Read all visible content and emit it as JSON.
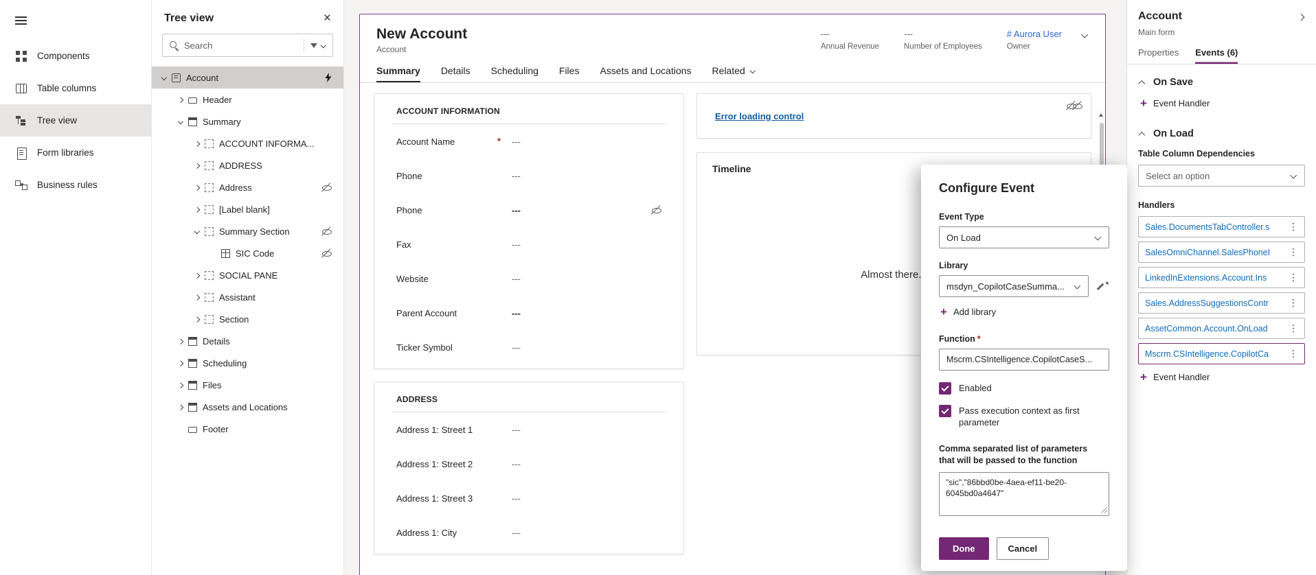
{
  "colors": {
    "accent_purple": "#742774",
    "link_blue": "#115ea3",
    "owner_blue": "#2266E3",
    "required_red": "#a4262c"
  },
  "left_nav": {
    "items": [
      {
        "label": "Components",
        "icon": "components-icon"
      },
      {
        "label": "Table columns",
        "icon": "table-columns-icon"
      },
      {
        "label": "Tree view",
        "icon": "tree-view-icon",
        "selected": true
      },
      {
        "label": "Form libraries",
        "icon": "form-libraries-icon"
      },
      {
        "label": "Business rules",
        "icon": "business-rules-icon"
      }
    ]
  },
  "tree_panel": {
    "title": "Tree view",
    "search_placeholder": "Search",
    "items": [
      {
        "label": "Account",
        "icon": "form-icon",
        "chevron": "down",
        "depth": 0,
        "selected": true,
        "bolt": true
      },
      {
        "label": "Header",
        "icon": "label-icon",
        "chevron": "right",
        "depth": 1
      },
      {
        "label": "Summary",
        "icon": "tab-icon",
        "chevron": "down",
        "depth": 1
      },
      {
        "label": "ACCOUNT INFORMA...",
        "icon": "section-icon",
        "chevron": "right",
        "depth": 2
      },
      {
        "label": "ADDRESS",
        "icon": "section-icon",
        "chevron": "right",
        "depth": 2
      },
      {
        "label": "Address",
        "icon": "section-icon",
        "chevron": "right",
        "depth": 2,
        "hidden": true
      },
      {
        "label": "[Label blank]",
        "icon": "section-icon",
        "chevron": "right",
        "depth": 2
      },
      {
        "label": "Summary Section",
        "icon": "section-icon",
        "chevron": "down",
        "depth": 2,
        "hidden": true
      },
      {
        "label": "SIC Code",
        "icon": "grid-icon",
        "chevron": "none",
        "depth": 3,
        "hidden": true
      },
      {
        "label": "SOCIAL PANE",
        "icon": "section-icon",
        "chevron": "right",
        "depth": 2
      },
      {
        "label": "Assistant",
        "icon": "section-icon",
        "chevron": "right",
        "depth": 2
      },
      {
        "label": "Section",
        "icon": "section-icon",
        "chevron": "right",
        "depth": 2
      },
      {
        "label": "Details",
        "icon": "tab-icon",
        "chevron": "right",
        "depth": 1
      },
      {
        "label": "Scheduling",
        "icon": "tab-icon",
        "chevron": "right",
        "depth": 1
      },
      {
        "label": "Files",
        "icon": "tab-icon",
        "chevron": "right",
        "depth": 1
      },
      {
        "label": "Assets and Locations",
        "icon": "tab-icon",
        "chevron": "right",
        "depth": 1
      },
      {
        "label": "Footer",
        "icon": "label-icon",
        "chevron": "none",
        "depth": 1
      }
    ]
  },
  "form": {
    "title": "New Account",
    "entity": "Account",
    "header_stats": [
      {
        "value": "---",
        "label": "Annual Revenue"
      },
      {
        "value": "---",
        "label": "Number of Employees"
      },
      {
        "value": "# Aurora User",
        "label": "Owner",
        "link": true
      }
    ],
    "tabs": [
      {
        "label": "Summary",
        "selected": true
      },
      {
        "label": "Details"
      },
      {
        "label": "Scheduling"
      },
      {
        "label": "Files"
      },
      {
        "label": "Assets and Locations"
      },
      {
        "label": "Related",
        "dropdown": true
      }
    ],
    "account_information": {
      "title": "ACCOUNT INFORMATION",
      "fields": [
        {
          "label": "Account Name",
          "value": "---",
          "required": true
        },
        {
          "label": "Phone",
          "value": "---"
        },
        {
          "label": "Phone",
          "value": "---",
          "bold": true,
          "hidden": true
        },
        {
          "label": "Fax",
          "value": "---"
        },
        {
          "label": "Website",
          "value": "---"
        },
        {
          "label": "Parent Account",
          "value": "---",
          "bold": true
        },
        {
          "label": "Ticker Symbol",
          "value": "---"
        }
      ]
    },
    "address": {
      "title": "ADDRESS",
      "fields": [
        {
          "label": "Address 1: Street 1",
          "value": "---"
        },
        {
          "label": "Address 1: Street 2",
          "value": "---"
        },
        {
          "label": "Address 1: Street 3",
          "value": "---"
        },
        {
          "label": "Address 1: City",
          "value": "---"
        }
      ]
    },
    "error_card": {
      "link_text": "Error loading control"
    },
    "timeline": {
      "title": "Timeline",
      "status_text": "Almost there..."
    }
  },
  "dialog": {
    "title": "Configure Event",
    "event_type": {
      "label": "Event Type",
      "value": "On Load"
    },
    "library": {
      "label": "Library",
      "value": "msdyn_CopilotCaseSumma..."
    },
    "add_library_label": "Add library",
    "function": {
      "label": "Function",
      "required_mark": "*",
      "value": "Mscrm.CSIntelligence.CopilotCaseS..."
    },
    "enabled_label": "Enabled",
    "pass_context_label": "Pass execution context as first parameter",
    "parameters_label": "Comma separated list of parameters that will be passed to the function",
    "parameters_value": "\"sic\",\"86bbd0be-4aea-ef11-be20-6045bd0a4647\"",
    "done_label": "Done",
    "cancel_label": "Cancel"
  },
  "right_panel": {
    "title": "Account",
    "subtitle": "Main form",
    "tabs": [
      {
        "label": "Properties"
      },
      {
        "label": "Events (6)",
        "selected": true
      }
    ],
    "on_save": {
      "title": "On Save",
      "add_handler_label": "Event Handler"
    },
    "on_load": {
      "title": "On Load",
      "dependencies_label": "Table Column Dependencies",
      "dependencies_placeholder": "Select an option",
      "handlers_label": "Handlers",
      "handlers": [
        {
          "name": "Sales.DocumentsTabController.s"
        },
        {
          "name": "SalesOmniChannel.SalesPhoneI"
        },
        {
          "name": "LinkedInExtensions.Account.Ins"
        },
        {
          "name": "Sales.AddressSuggestionsContr"
        },
        {
          "name": "AssetCommon.Account.OnLoad"
        },
        {
          "name": "Mscrm.CSIntelligence.CopilotCa",
          "selected": true
        }
      ],
      "add_handler_label": "Event Handler"
    }
  }
}
